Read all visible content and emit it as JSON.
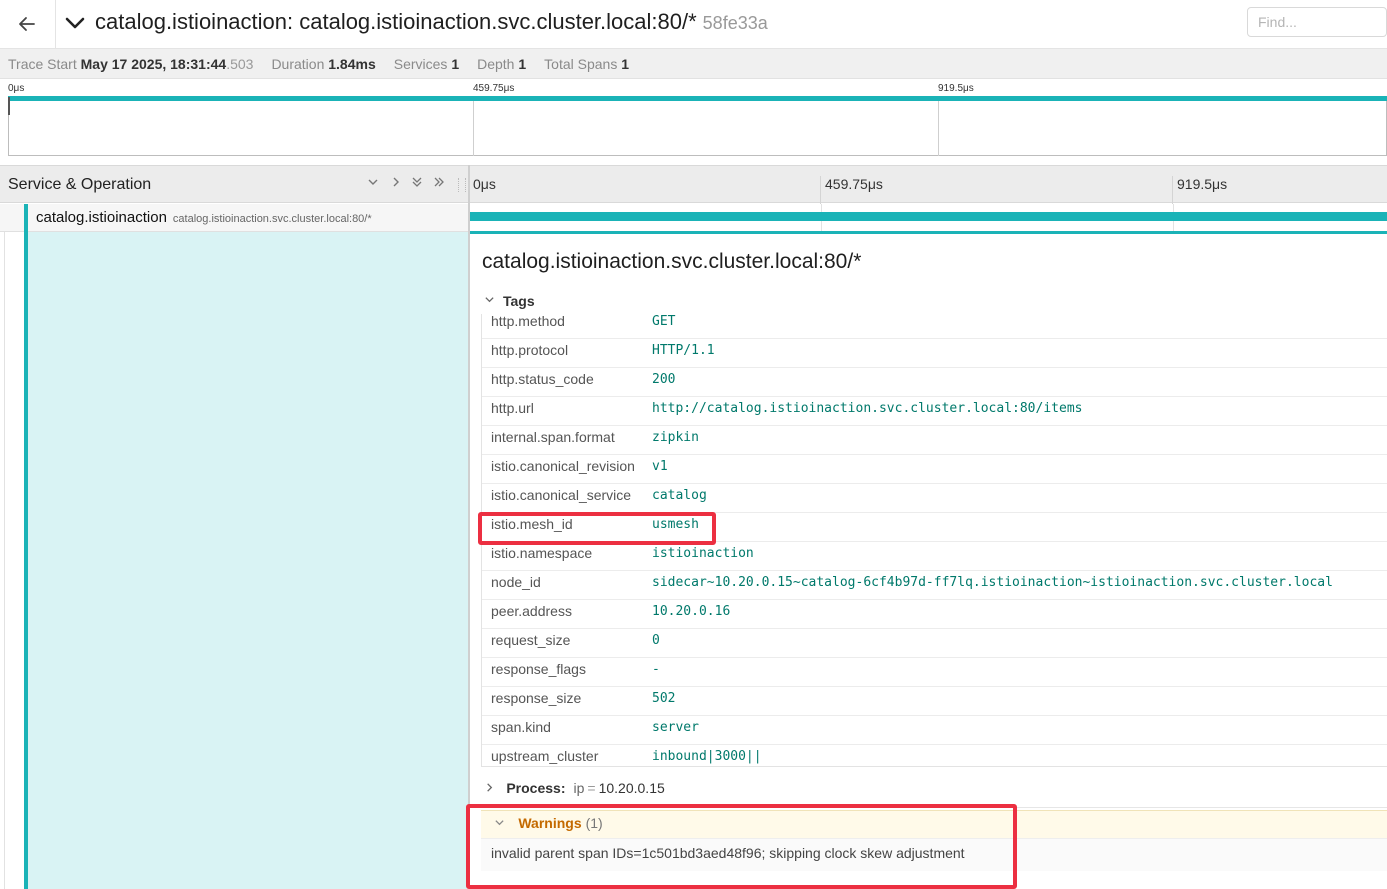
{
  "header": {
    "back_icon": "arrow-left-icon",
    "collapse_icon": "chevron-down-icon",
    "title": "catalog.istioinaction: catalog.istioinaction.svc.cluster.local:80/*",
    "trace_id": "58fe33a",
    "find_placeholder": "Find..."
  },
  "summary": {
    "trace_start_label": "Trace Start",
    "trace_start_value": "May 17 2025, 18:31:44",
    "trace_start_ms": ".503",
    "duration_label": "Duration",
    "duration_value": "1.84ms",
    "services_label": "Services",
    "services_value": "1",
    "depth_label": "Depth",
    "depth_value": "1",
    "total_spans_label": "Total Spans",
    "total_spans_value": "1"
  },
  "minimap": {
    "ticks": [
      "0μs",
      "459.75μs",
      "919.5μs"
    ]
  },
  "columns": {
    "left_title": "Service & Operation",
    "controls": [
      "⌵",
      "›",
      "⌄⌄",
      "»"
    ],
    "timeline_ticks": [
      "0μs",
      "459.75μs",
      "919.5μs"
    ]
  },
  "span": {
    "service": "catalog.istioinaction",
    "operation": "catalog.istioinaction.svc.cluster.local:80/*",
    "bar_color": "#1ab3b7"
  },
  "detail": {
    "title": "catalog.istioinaction.svc.cluster.local:80/*",
    "tags_label": "Tags",
    "tags": [
      {
        "key": "http.method",
        "value": "GET"
      },
      {
        "key": "http.protocol",
        "value": "HTTP/1.1"
      },
      {
        "key": "http.status_code",
        "value": "200"
      },
      {
        "key": "http.url",
        "value": "http://catalog.istioinaction.svc.cluster.local:80/items"
      },
      {
        "key": "internal.span.format",
        "value": "zipkin"
      },
      {
        "key": "istio.canonical_revision",
        "value": "v1"
      },
      {
        "key": "istio.canonical_service",
        "value": "catalog"
      },
      {
        "key": "istio.mesh_id",
        "value": "usmesh"
      },
      {
        "key": "istio.namespace",
        "value": "istioinaction"
      },
      {
        "key": "node_id",
        "value": "sidecar~10.20.0.15~catalog-6cf4b97d-ff7lq.istioinaction~istioinaction.svc.cluster.local"
      },
      {
        "key": "peer.address",
        "value": "10.20.0.16"
      },
      {
        "key": "request_size",
        "value": "0"
      },
      {
        "key": "response_flags",
        "value": "-"
      },
      {
        "key": "response_size",
        "value": "502"
      },
      {
        "key": "span.kind",
        "value": "server"
      },
      {
        "key": "upstream_cluster",
        "value": "inbound|3000||"
      }
    ],
    "process_label": "Process:",
    "process_key": "ip",
    "process_eq": "=",
    "process_value": "10.20.0.15",
    "warnings_label": "Warnings",
    "warnings_count": "(1)",
    "warning_text": "invalid parent span IDs=1c501bd3aed48f96; skipping clock skew adjustment"
  },
  "colors": {
    "accent": "#1ab3b7",
    "highlight": "#ec2f41",
    "warning": "#c46a00",
    "tag_value": "#00796b"
  }
}
